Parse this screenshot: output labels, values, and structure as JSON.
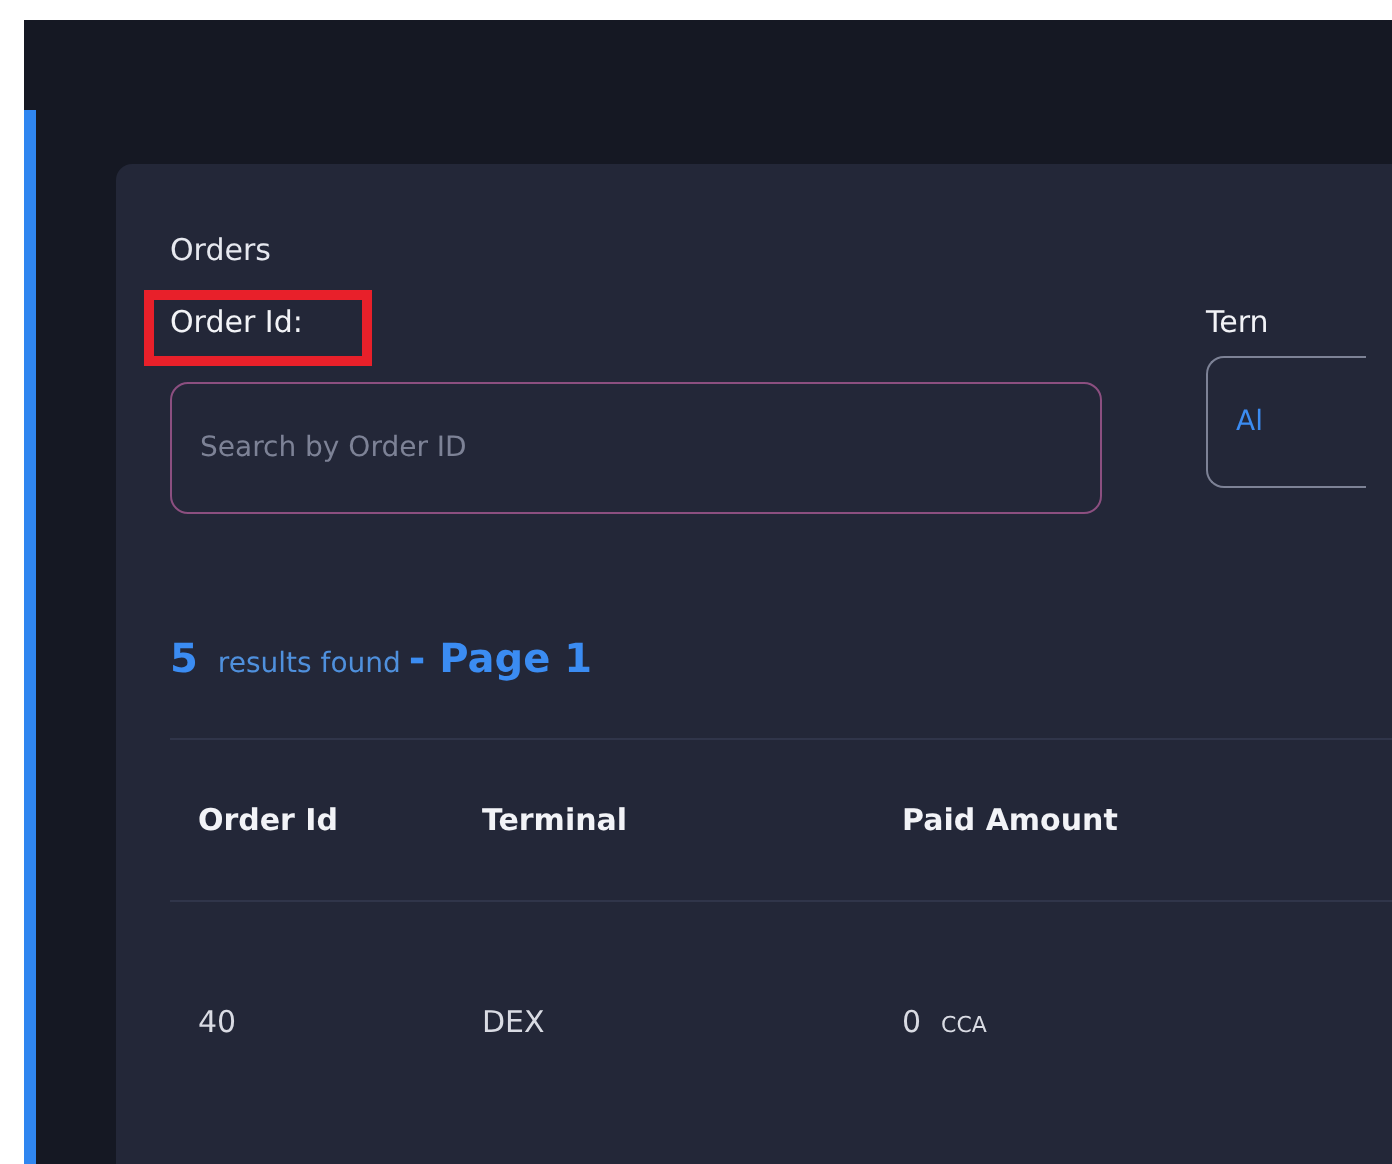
{
  "panel": {
    "title": "Orders",
    "filters": [
      {
        "kind": "text",
        "label": "Order Id:",
        "highlighted": true,
        "placeholder": "Search by Order ID"
      },
      {
        "kind": "select",
        "label": "Tern",
        "highlighted": false,
        "value": "Al"
      }
    ]
  },
  "results": {
    "count": "5",
    "text": "results found",
    "page": "- Page 1"
  },
  "table": {
    "columns": [
      "Order Id",
      "Terminal",
      "Paid Amount"
    ],
    "rows": [
      {
        "order_id": "40",
        "terminal": "DEX",
        "amount": "0",
        "currency": "CCA"
      }
    ]
  }
}
